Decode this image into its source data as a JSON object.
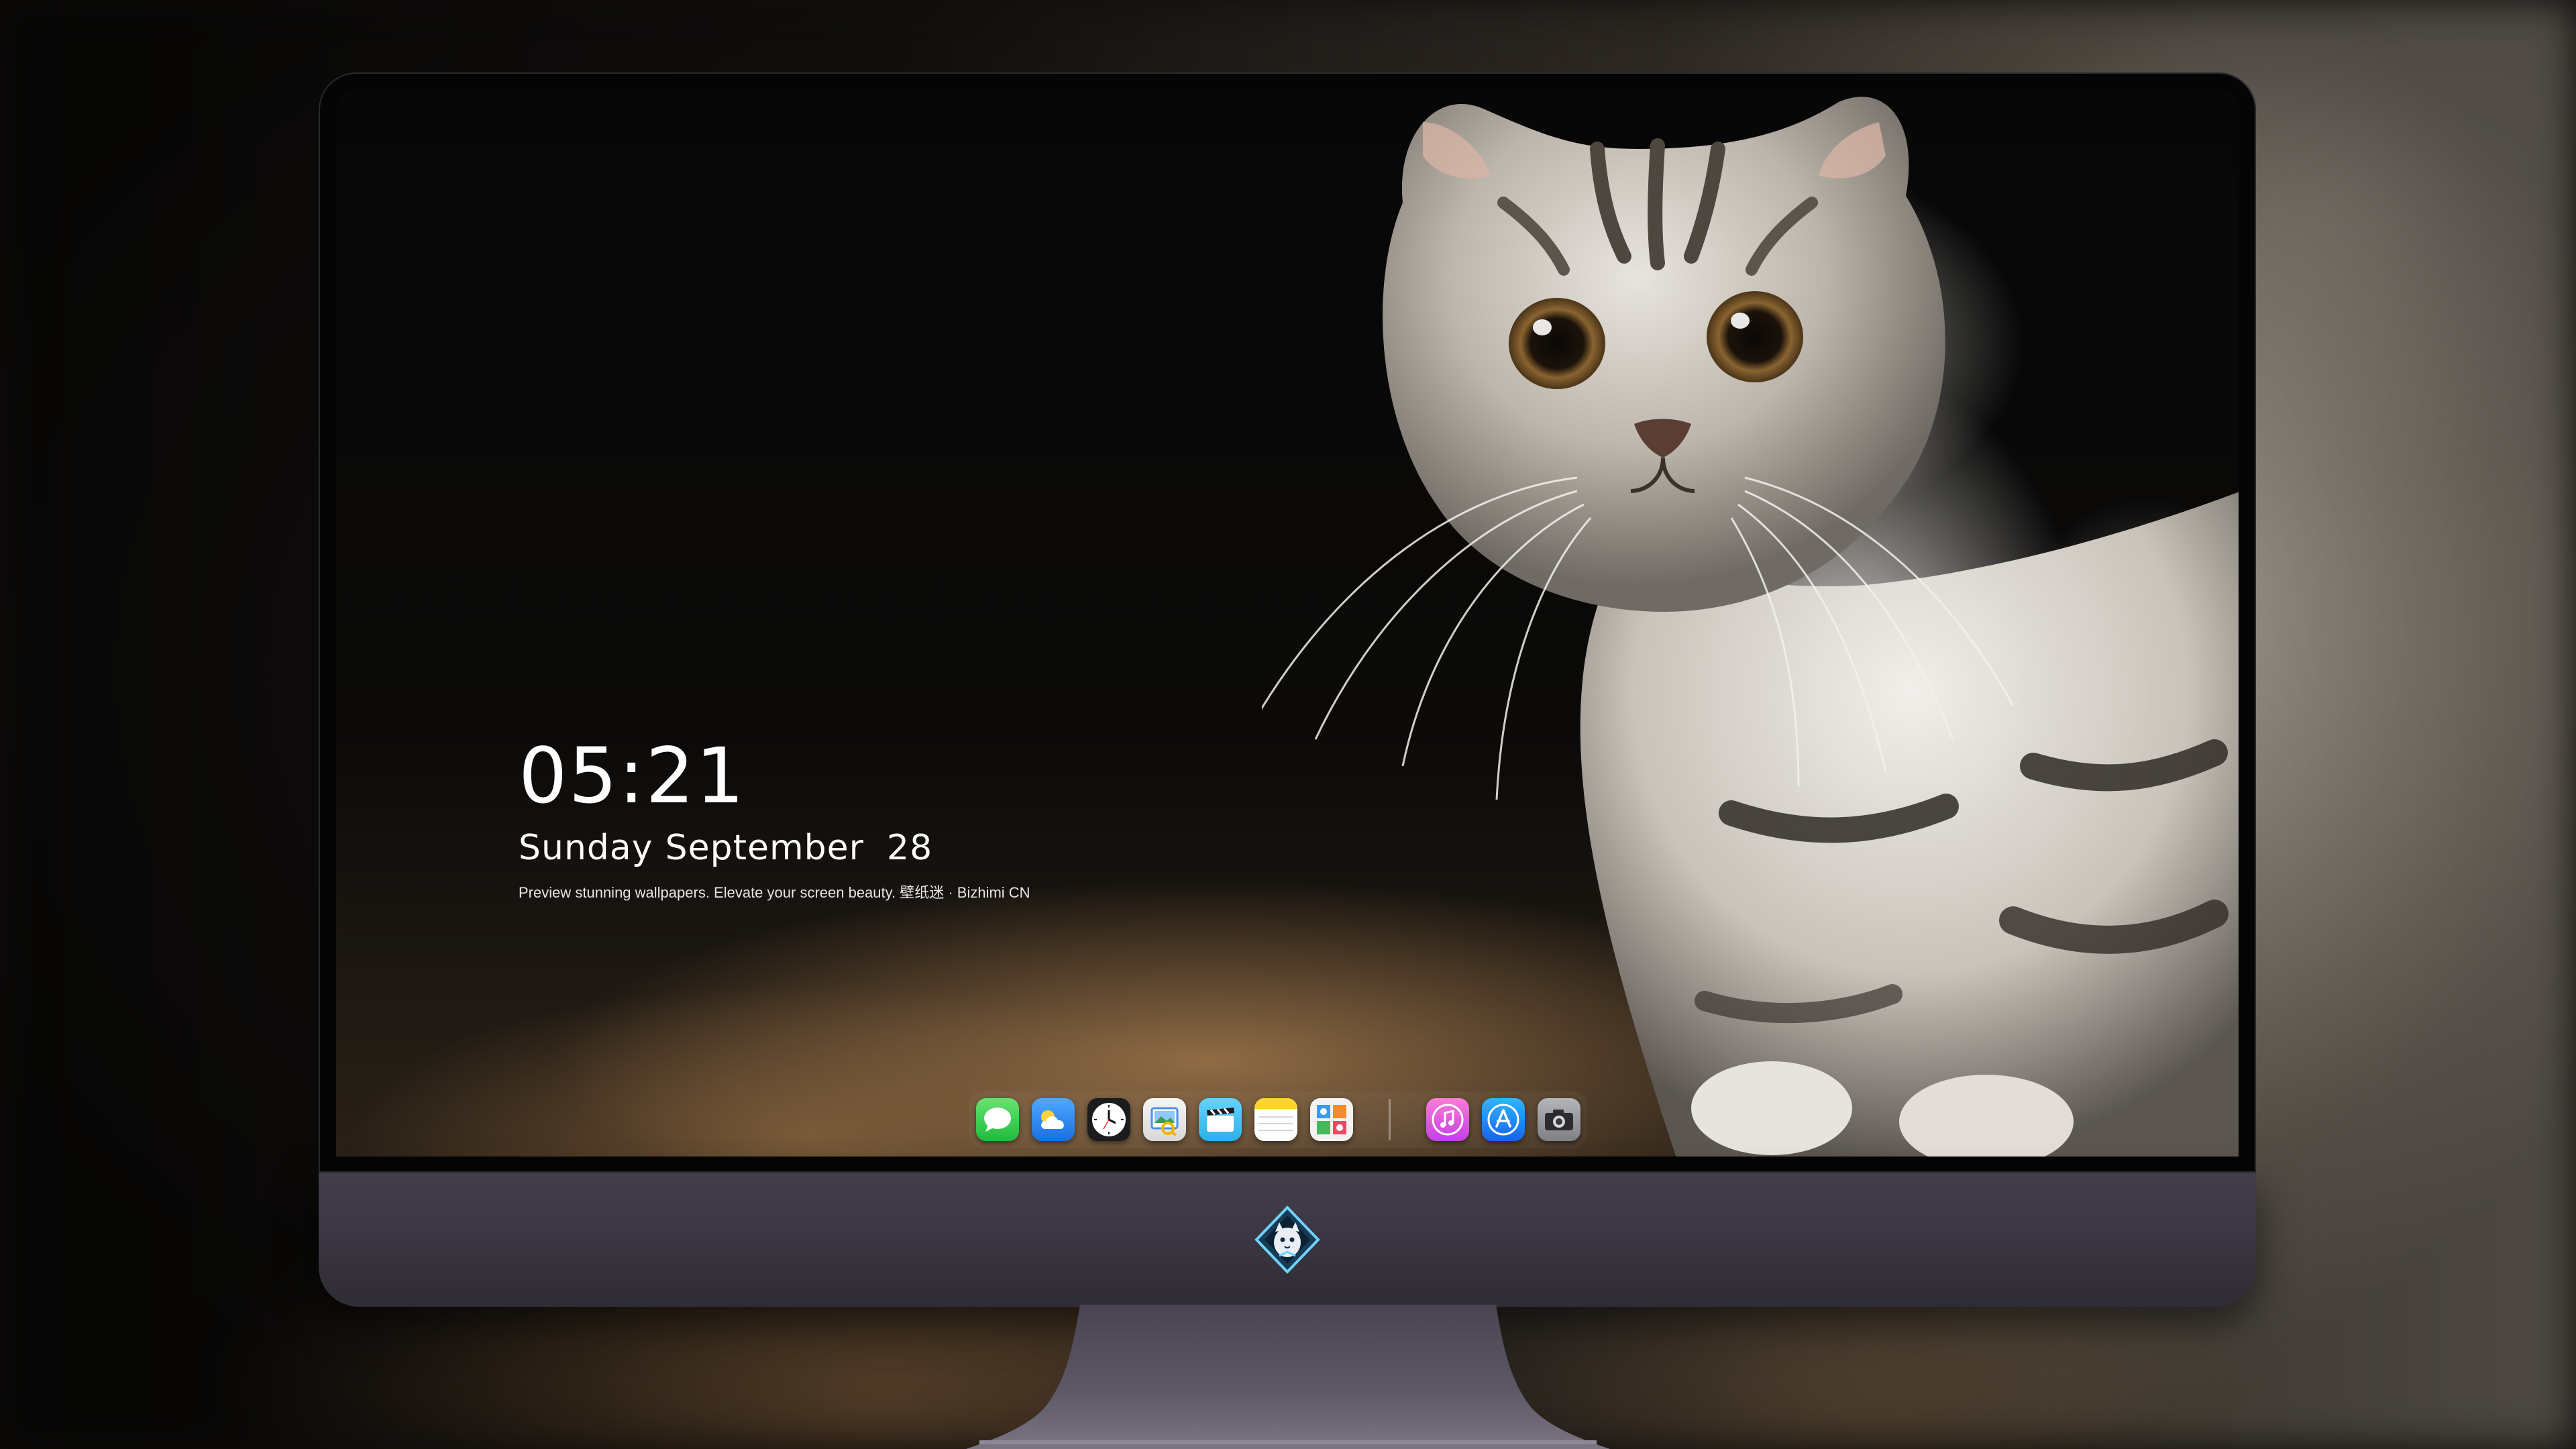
{
  "lock_screen": {
    "time": "05:21",
    "weekday": "Sunday",
    "month": "September",
    "day": "28",
    "tagline": "Preview stunning wallpapers. Elevate your screen beauty. 壁纸迷 · Bizhimi CN"
  },
  "dock": {
    "apps": [
      {
        "name": "messages-icon",
        "color": "#2fd158"
      },
      {
        "name": "weather-icon",
        "color": "#2e8ef6"
      },
      {
        "name": "clock-icon",
        "color": "#1c1c1e"
      },
      {
        "name": "preview-icon",
        "color": "#f2f2f2"
      },
      {
        "name": "clips-icon",
        "color": "#4fc3f7"
      },
      {
        "name": "notes-icon",
        "color": "#ffd42a"
      },
      {
        "name": "photo-booth-icon",
        "color": "#f4f4f4"
      },
      {
        "name": "itunes-icon",
        "color": "#f45fd8"
      },
      {
        "name": "app-store-icon",
        "color": "#1a8cff"
      },
      {
        "name": "camera-icon",
        "color": "#9a9ca2"
      }
    ]
  },
  "colors": {
    "chin": "#3b3743",
    "bezel": "#050505",
    "text": "#ffffff"
  }
}
